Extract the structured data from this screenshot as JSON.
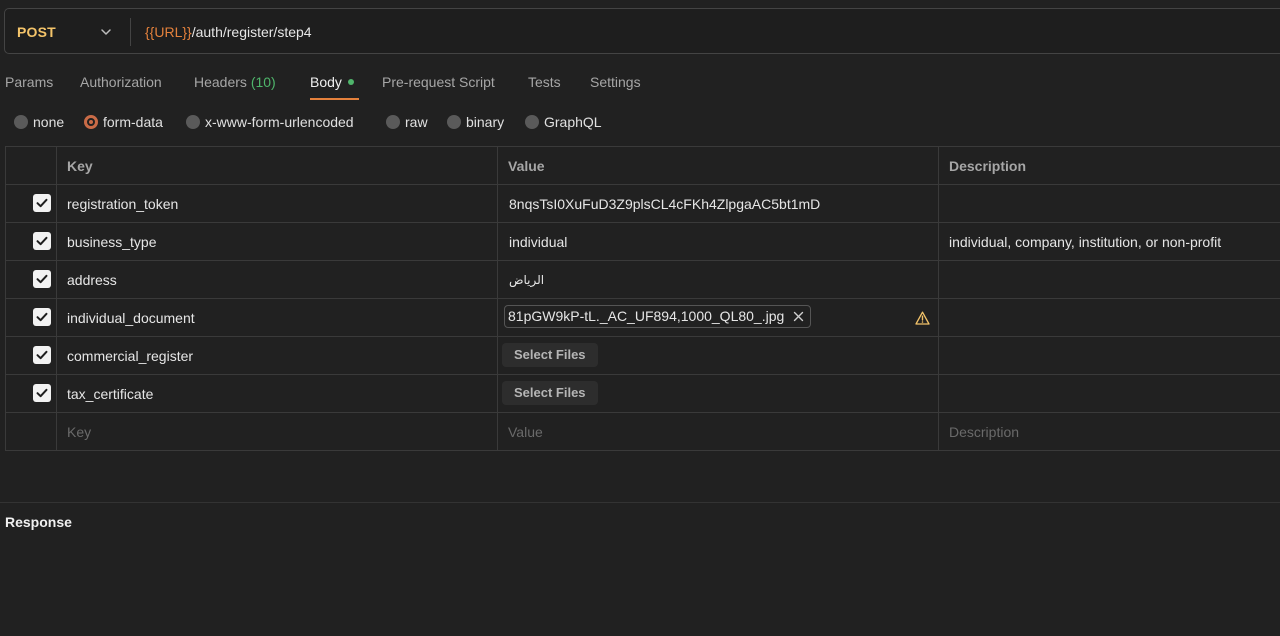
{
  "request": {
    "method": "POST",
    "url_var": "{{URL}}",
    "url_path": "/auth/register/step4"
  },
  "tabs": [
    {
      "label": "Params"
    },
    {
      "label": "Authorization"
    },
    {
      "label": "Headers",
      "count": "(10)"
    },
    {
      "label": "Body"
    },
    {
      "label": "Pre-request Script"
    },
    {
      "label": "Tests"
    },
    {
      "label": "Settings"
    }
  ],
  "body_types": [
    {
      "label": "none"
    },
    {
      "label": "form-data"
    },
    {
      "label": "x-www-form-urlencoded"
    },
    {
      "label": "raw"
    },
    {
      "label": "binary"
    },
    {
      "label": "GraphQL"
    }
  ],
  "selected_body_type": "form-data",
  "table": {
    "headers": {
      "key": "Key",
      "value": "Value",
      "description": "Description"
    },
    "rows": [
      {
        "key": "registration_token",
        "value": "8nqsTsI0XuFuD3Z9plsCL4cFKh4ZlpgaAC5bt1mD",
        "description": ""
      },
      {
        "key": "business_type",
        "value": "individual",
        "description": "individual, company, institution, or non-profit"
      },
      {
        "key": "address",
        "value": "الرياض",
        "description": ""
      },
      {
        "key": "individual_document",
        "file": "81pGW9kP-tL._AC_UF894,1000_QL80_.jpg",
        "description": ""
      },
      {
        "key": "commercial_register",
        "button": "Select Files",
        "description": ""
      },
      {
        "key": "tax_certificate",
        "button": "Select Files",
        "description": ""
      }
    ],
    "placeholders": {
      "key": "Key",
      "value": "Value",
      "description": "Description"
    }
  },
  "response": {
    "title": "Response"
  },
  "colors": {
    "method": "#f4c46a",
    "url_var": "#e4813c",
    "accent": "#e4813c",
    "count": "#4fb56b",
    "warning": "#f4c46a"
  }
}
